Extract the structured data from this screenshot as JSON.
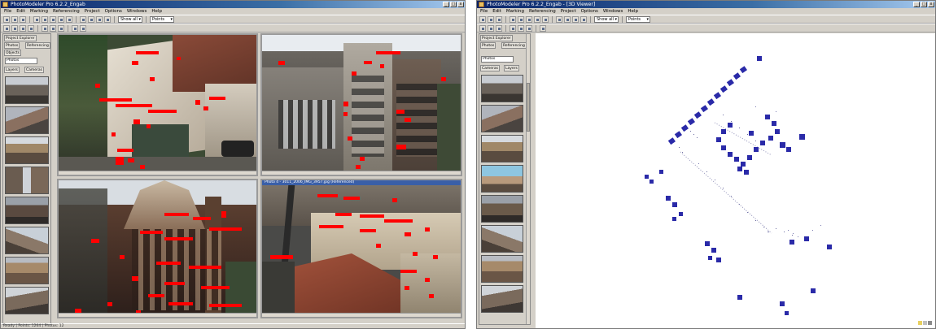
{
  "left_window": {
    "title": "PhotoModeler Pro 6.2.2_Engab",
    "menu": [
      "File",
      "Edit",
      "Marking",
      "Referencing",
      "Project",
      "Options",
      "Windows",
      "Help"
    ],
    "combo_1": "Show all",
    "combo_2": "Points",
    "panel_tabs": [
      "Project Explorer",
      "Photos",
      "Referencing",
      "Objects"
    ],
    "panel_select": "Photos",
    "panel_subtabs": [
      "Layers",
      "Cameras"
    ],
    "viewport_4_title": "Photo 4 - 3011_2006_IMG_3957.jpg (Referenced)",
    "status": "Ready   |  Points: 1264   |  Photos: 12",
    "colors": {
      "marker": "#ff0000",
      "title_bar": "#0a246a",
      "chrome": "#d4d0c8"
    }
  },
  "right_window": {
    "title": "PhotoModeler Pro 6.2.2_Engab - [3D Viewer]",
    "menu": [
      "File",
      "Edit",
      "Marking",
      "Referencing",
      "Project",
      "Options",
      "Windows",
      "Help"
    ],
    "combo_1": "Show all",
    "combo_2": "Points",
    "panel_tabs": [
      "Project Explorer",
      "Photos",
      "Referencing"
    ],
    "panel_select": "Photos",
    "panel_subtabs": [
      "Cameras",
      "Layers"
    ],
    "colors": {
      "point_cloud": "#2a2aa8",
      "camera": "#1a1a6a",
      "background": "#ffffff"
    }
  },
  "icons": {
    "window_minimize": "minimize-icon",
    "window_maximize": "maximize-icon",
    "window_close": "close-icon",
    "window_close_glyph": "x"
  }
}
